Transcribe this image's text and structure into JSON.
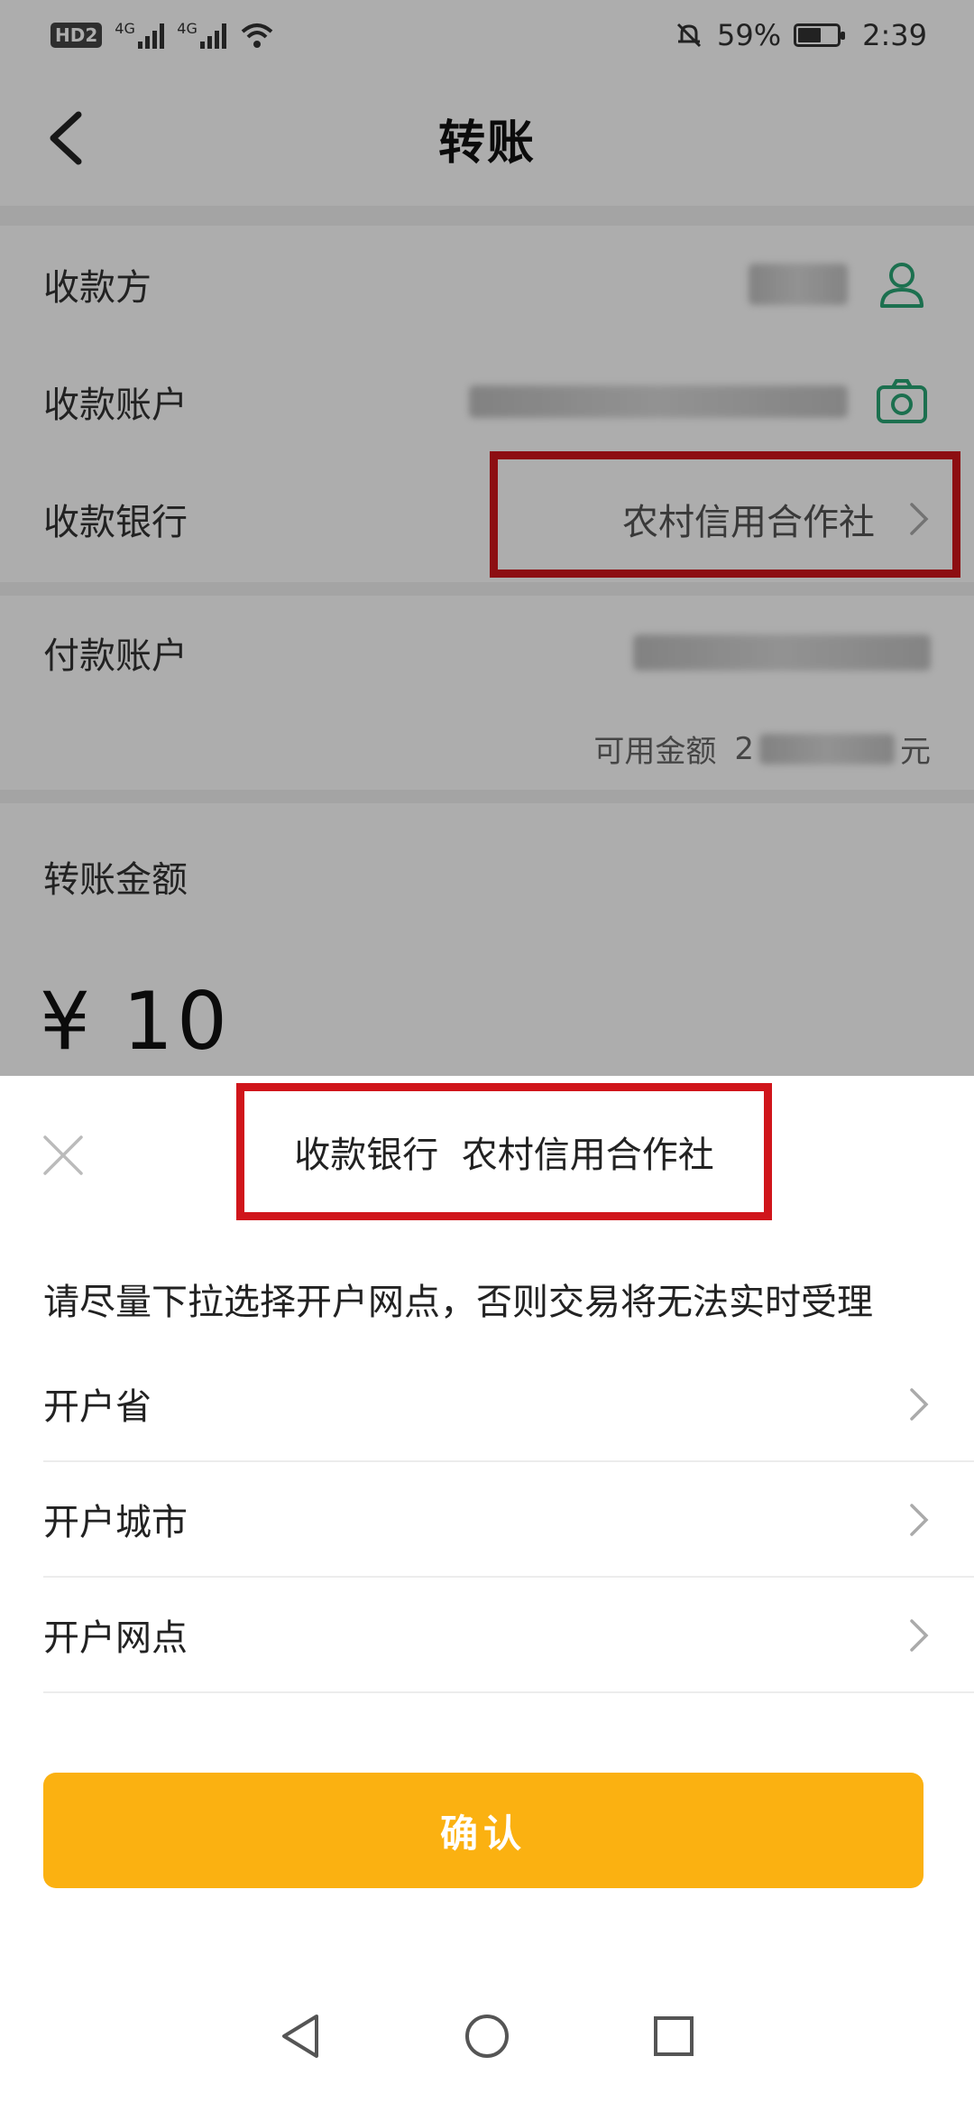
{
  "status_bar": {
    "hd_label": "HD",
    "hd_sub": "2",
    "net1": "4G",
    "net2": "4G",
    "battery_percent": "59%",
    "battery_level": 0.59,
    "time": "2:39"
  },
  "header": {
    "title": "转账"
  },
  "form": {
    "payee_label": "收款方",
    "account_label": "收款账户",
    "bank_label": "收款银行",
    "bank_value": "农村信用合作社",
    "pay_account_label": "付款账户",
    "available_label": "可用金额",
    "available_prefix": "2",
    "available_suffix": "元",
    "amount_label": "转账金额",
    "amount_value": "¥ 10"
  },
  "sheet": {
    "title": "收款银行  农村信用合作社",
    "hint": "请尽量下拉选择开户网点，否则交易将无法实时受理",
    "pickers": [
      {
        "label": "开户省"
      },
      {
        "label": "开户城市"
      },
      {
        "label": "开户网点"
      }
    ],
    "confirm_label": "确认"
  },
  "colors": {
    "accent": "#fbb111",
    "icon_green": "#2aa575",
    "highlight": "#d0151b"
  },
  "icons": [
    "back-icon",
    "person-icon",
    "camera-icon",
    "chevron-right-icon",
    "close-icon",
    "nav-back-icon",
    "nav-home-icon",
    "nav-recent-icon"
  ]
}
